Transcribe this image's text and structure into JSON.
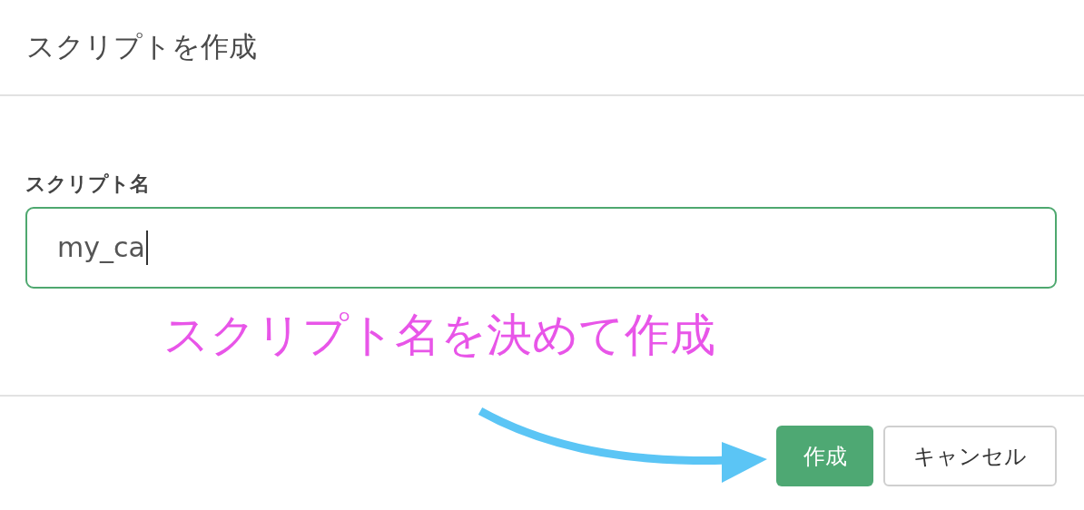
{
  "dialog": {
    "title": "スクリプトを作成"
  },
  "field": {
    "label": "スクリプト名",
    "value": "my_ca"
  },
  "annotation": {
    "text": "スクリプト名を決めて作成"
  },
  "buttons": [
    {
      "label": "作成",
      "kind": "primary"
    },
    {
      "label": "キャンセル",
      "kind": "secondary"
    }
  ]
}
